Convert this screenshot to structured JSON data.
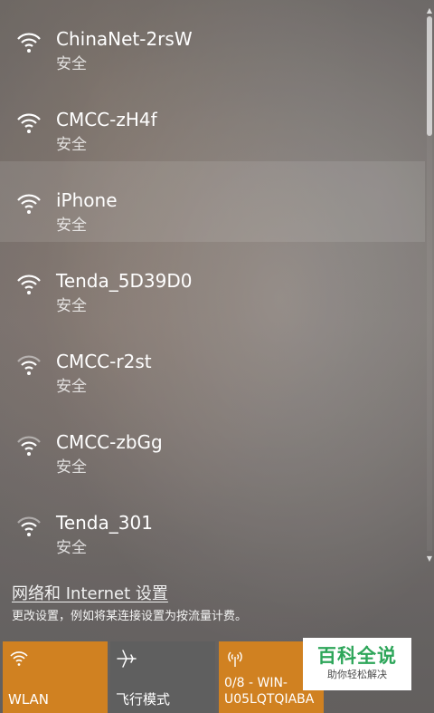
{
  "networks": [
    {
      "name": "ChinaNet-2rsW",
      "status": "安全",
      "icon": "wifi-icon"
    },
    {
      "name": "CMCC-zH4f",
      "status": "安全",
      "icon": "wifi-icon"
    },
    {
      "name": "iPhone",
      "status": "安全",
      "icon": "wifi-icon",
      "highlighted": true
    },
    {
      "name": "Tenda_5D39D0",
      "status": "安全",
      "icon": "wifi-icon"
    },
    {
      "name": "CMCC-r2st",
      "status": "安全",
      "icon": "wifi-icon"
    },
    {
      "name": "CMCC-zbGg",
      "status": "安全",
      "icon": "wifi-icon"
    },
    {
      "name": "Tenda_301",
      "status": "安全",
      "icon": "wifi-icon"
    }
  ],
  "settings": {
    "link_label": "网络和 Internet 设置",
    "description": "更改设置，例如将某连接设置为按流量计费。"
  },
  "quick_actions": [
    {
      "label": "WLAN",
      "icon": "wifi-icon",
      "active": true
    },
    {
      "label": "飞行模式",
      "icon": "airplane-icon",
      "active": false
    },
    {
      "label": "0/8 - WIN-U05LQTQIABA",
      "icon": "mobile-hotspot-icon",
      "active": true
    }
  ],
  "watermark": {
    "title": "百科全说",
    "subtitle": "助你轻松解决"
  },
  "colors": {
    "accent": "#d08121",
    "tile_inactive": "#5f5f5f",
    "watermark_green": "#2ea65a"
  },
  "icons": {
    "scroll_up": "▲",
    "scroll_down": "▼"
  }
}
